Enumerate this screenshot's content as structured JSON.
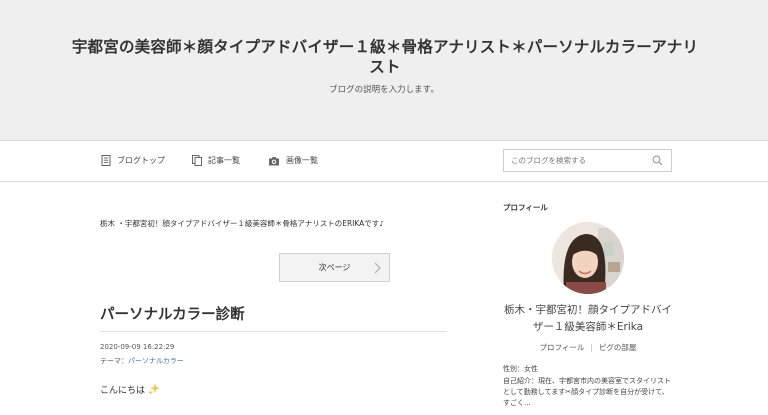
{
  "header": {
    "title": "宇都宮の美容師＊顔タイプアドバイザー１級＊骨格アナリスト＊パーソナルカラーアナリスト",
    "description": "ブログの説明を入力します。"
  },
  "nav": {
    "items": [
      {
        "label": "ブログトップ",
        "icon": "document-icon"
      },
      {
        "label": "記事一覧",
        "icon": "copy-icon"
      },
      {
        "label": "画像一覧",
        "icon": "camera-icon"
      }
    ],
    "search_placeholder": "このブログを検索する"
  },
  "main": {
    "intro": "栃木 ・宇都宮初！顔タイプアドバイザー１級美容師＊骨格アナリストのERIKAです♪",
    "next_label": "次ページ",
    "entry": {
      "title": "パーソナルカラー診断",
      "date": "2020-09-09 16:22:29",
      "theme_prefix": "テーマ：",
      "theme": "パーソナルカラー",
      "body_start": "こんにちは"
    }
  },
  "sidebar": {
    "heading": "プロフィール",
    "name": "栃木・宇都宮初！顔タイプアドバイザー１級美容師＊Erika",
    "links": [
      "プロフィール",
      "ピグの部屋"
    ],
    "gender": "性別：女性",
    "bio": "自己紹介：現在、宇都宮市内の美容室でスタイリストとして勤務してます✂︎顔タイプ診断を自分が受けて、すごく..."
  },
  "colors": {
    "header_bg": "#efefef",
    "link": "#3d6fa8",
    "sparkle": "#f2c94c"
  }
}
